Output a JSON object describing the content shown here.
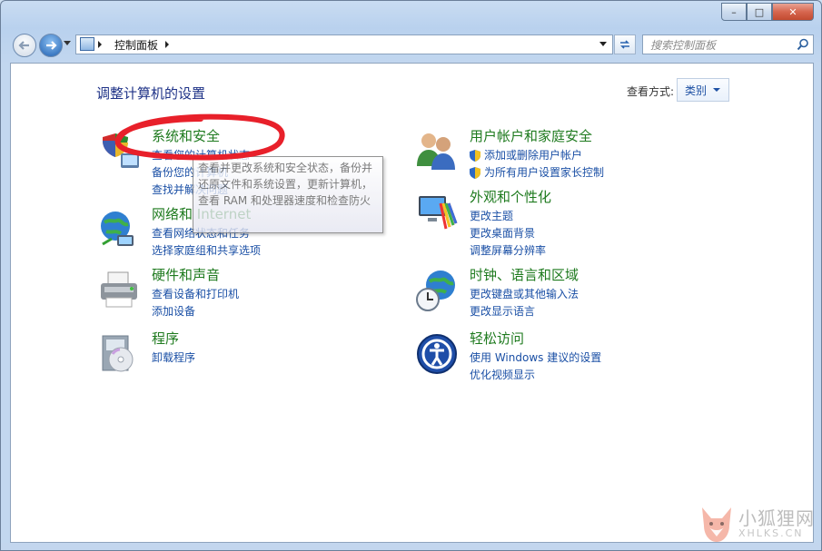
{
  "window": {
    "controls": {
      "minimize": "–",
      "maximize": "□",
      "close": "✕"
    }
  },
  "navbar": {
    "breadcrumb": "控制面板",
    "search_placeholder": "搜索控制面板"
  },
  "main": {
    "page_title": "调整计算机的设置",
    "view_by_label": "查看方式:",
    "view_by_value": "类别",
    "categories": [
      {
        "title": "系统和安全",
        "icon": "system-security-icon",
        "links": [
          "查看您的计算机状态",
          "备份您的计算机",
          "查找并解决问题"
        ]
      },
      {
        "title": "网络和 Internet",
        "icon": "network-globe-icon",
        "links": [
          "查看网络状态和任务",
          "选择家庭组和共享选项"
        ]
      },
      {
        "title": "硬件和声音",
        "icon": "printer-icon",
        "links": [
          "查看设备和打印机",
          "添加设备"
        ]
      },
      {
        "title": "程序",
        "icon": "programs-disc-icon",
        "links": [
          "卸载程序"
        ]
      },
      {
        "title": "用户帐户和家庭安全",
        "icon": "users-icon",
        "links": [
          "添加或删除用户帐户",
          "为所有用户设置家长控制"
        ]
      },
      {
        "title": "外观和个性化",
        "icon": "appearance-monitor-icon",
        "links": [
          "更改主题",
          "更改桌面背景",
          "调整屏幕分辨率"
        ]
      },
      {
        "title": "时钟、语言和区域",
        "icon": "clock-globe-icon",
        "links": [
          "更改键盘或其他输入法",
          "更改显示语言"
        ]
      },
      {
        "title": "轻松访问",
        "icon": "ease-of-access-icon",
        "links": [
          "使用 Windows 建议的设置",
          "优化视频显示"
        ]
      }
    ],
    "tooltip": "查看并更改系统和安全状态，备份并还原文件和系统设置，更新计算机，查看 RAM 和处理器速度和检查防火"
  },
  "watermark": {
    "line1": "小狐狸网",
    "line2": "XHLKS.CN"
  },
  "colors": {
    "heading_green": "#1e7a1e",
    "link_blue": "#1a4fa5",
    "title_navy": "#1e3287",
    "annotation_red": "#e8202a"
  }
}
